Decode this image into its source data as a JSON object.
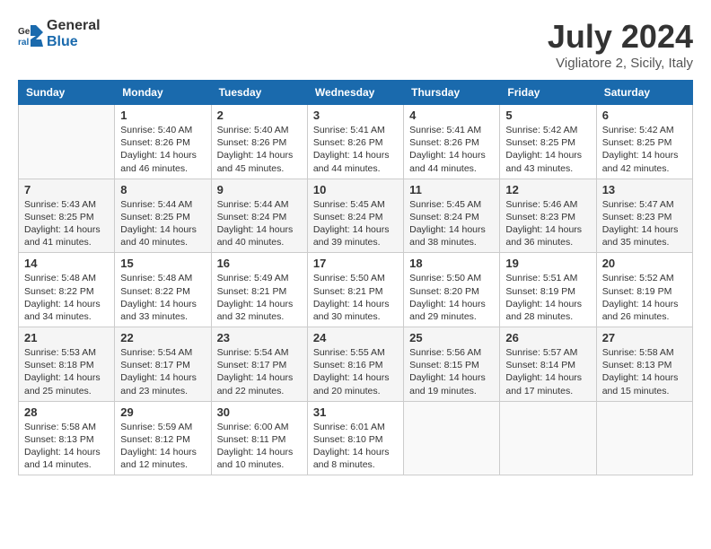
{
  "header": {
    "logo_general": "General",
    "logo_blue": "Blue",
    "title": "July 2024",
    "subtitle": "Vigliatore 2, Sicily, Italy"
  },
  "weekdays": [
    "Sunday",
    "Monday",
    "Tuesday",
    "Wednesday",
    "Thursday",
    "Friday",
    "Saturday"
  ],
  "weeks": [
    [
      {
        "num": "",
        "info": ""
      },
      {
        "num": "1",
        "info": "Sunrise: 5:40 AM\nSunset: 8:26 PM\nDaylight: 14 hours\nand 46 minutes."
      },
      {
        "num": "2",
        "info": "Sunrise: 5:40 AM\nSunset: 8:26 PM\nDaylight: 14 hours\nand 45 minutes."
      },
      {
        "num": "3",
        "info": "Sunrise: 5:41 AM\nSunset: 8:26 PM\nDaylight: 14 hours\nand 44 minutes."
      },
      {
        "num": "4",
        "info": "Sunrise: 5:41 AM\nSunset: 8:26 PM\nDaylight: 14 hours\nand 44 minutes."
      },
      {
        "num": "5",
        "info": "Sunrise: 5:42 AM\nSunset: 8:25 PM\nDaylight: 14 hours\nand 43 minutes."
      },
      {
        "num": "6",
        "info": "Sunrise: 5:42 AM\nSunset: 8:25 PM\nDaylight: 14 hours\nand 42 minutes."
      }
    ],
    [
      {
        "num": "7",
        "info": "Sunrise: 5:43 AM\nSunset: 8:25 PM\nDaylight: 14 hours\nand 41 minutes."
      },
      {
        "num": "8",
        "info": "Sunrise: 5:44 AM\nSunset: 8:25 PM\nDaylight: 14 hours\nand 40 minutes."
      },
      {
        "num": "9",
        "info": "Sunrise: 5:44 AM\nSunset: 8:24 PM\nDaylight: 14 hours\nand 40 minutes."
      },
      {
        "num": "10",
        "info": "Sunrise: 5:45 AM\nSunset: 8:24 PM\nDaylight: 14 hours\nand 39 minutes."
      },
      {
        "num": "11",
        "info": "Sunrise: 5:45 AM\nSunset: 8:24 PM\nDaylight: 14 hours\nand 38 minutes."
      },
      {
        "num": "12",
        "info": "Sunrise: 5:46 AM\nSunset: 8:23 PM\nDaylight: 14 hours\nand 36 minutes."
      },
      {
        "num": "13",
        "info": "Sunrise: 5:47 AM\nSunset: 8:23 PM\nDaylight: 14 hours\nand 35 minutes."
      }
    ],
    [
      {
        "num": "14",
        "info": "Sunrise: 5:48 AM\nSunset: 8:22 PM\nDaylight: 14 hours\nand 34 minutes."
      },
      {
        "num": "15",
        "info": "Sunrise: 5:48 AM\nSunset: 8:22 PM\nDaylight: 14 hours\nand 33 minutes."
      },
      {
        "num": "16",
        "info": "Sunrise: 5:49 AM\nSunset: 8:21 PM\nDaylight: 14 hours\nand 32 minutes."
      },
      {
        "num": "17",
        "info": "Sunrise: 5:50 AM\nSunset: 8:21 PM\nDaylight: 14 hours\nand 30 minutes."
      },
      {
        "num": "18",
        "info": "Sunrise: 5:50 AM\nSunset: 8:20 PM\nDaylight: 14 hours\nand 29 minutes."
      },
      {
        "num": "19",
        "info": "Sunrise: 5:51 AM\nSunset: 8:19 PM\nDaylight: 14 hours\nand 28 minutes."
      },
      {
        "num": "20",
        "info": "Sunrise: 5:52 AM\nSunset: 8:19 PM\nDaylight: 14 hours\nand 26 minutes."
      }
    ],
    [
      {
        "num": "21",
        "info": "Sunrise: 5:53 AM\nSunset: 8:18 PM\nDaylight: 14 hours\nand 25 minutes."
      },
      {
        "num": "22",
        "info": "Sunrise: 5:54 AM\nSunset: 8:17 PM\nDaylight: 14 hours\nand 23 minutes."
      },
      {
        "num": "23",
        "info": "Sunrise: 5:54 AM\nSunset: 8:17 PM\nDaylight: 14 hours\nand 22 minutes."
      },
      {
        "num": "24",
        "info": "Sunrise: 5:55 AM\nSunset: 8:16 PM\nDaylight: 14 hours\nand 20 minutes."
      },
      {
        "num": "25",
        "info": "Sunrise: 5:56 AM\nSunset: 8:15 PM\nDaylight: 14 hours\nand 19 minutes."
      },
      {
        "num": "26",
        "info": "Sunrise: 5:57 AM\nSunset: 8:14 PM\nDaylight: 14 hours\nand 17 minutes."
      },
      {
        "num": "27",
        "info": "Sunrise: 5:58 AM\nSunset: 8:13 PM\nDaylight: 14 hours\nand 15 minutes."
      }
    ],
    [
      {
        "num": "28",
        "info": "Sunrise: 5:58 AM\nSunset: 8:13 PM\nDaylight: 14 hours\nand 14 minutes."
      },
      {
        "num": "29",
        "info": "Sunrise: 5:59 AM\nSunset: 8:12 PM\nDaylight: 14 hours\nand 12 minutes."
      },
      {
        "num": "30",
        "info": "Sunrise: 6:00 AM\nSunset: 8:11 PM\nDaylight: 14 hours\nand 10 minutes."
      },
      {
        "num": "31",
        "info": "Sunrise: 6:01 AM\nSunset: 8:10 PM\nDaylight: 14 hours\nand 8 minutes."
      },
      {
        "num": "",
        "info": ""
      },
      {
        "num": "",
        "info": ""
      },
      {
        "num": "",
        "info": ""
      }
    ]
  ]
}
